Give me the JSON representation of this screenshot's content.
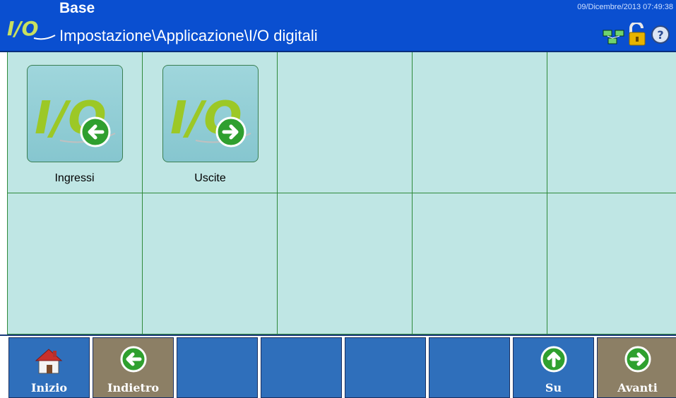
{
  "header": {
    "title": "Base",
    "path": "Impostazione\\Applicazione\\I/O digitali",
    "datetime": "09/Dicembre/2013 07:49:38",
    "logo_icon": "io-logo-icon",
    "status_icons": [
      "network-icon",
      "unlocked-padlock-icon",
      "help-icon"
    ]
  },
  "grid": {
    "items": [
      {
        "label": "Ingressi",
        "icon": "io-inputs-icon"
      },
      {
        "label": "Uscite",
        "icon": "io-outputs-icon"
      }
    ]
  },
  "toolbar": {
    "home_label": "Inizio",
    "back_label": "Indietro",
    "up_label": "Su",
    "next_label": "Avanti"
  },
  "colors": {
    "header": "#0a4fd0",
    "grid_background": "#bfe6e4",
    "grid_lines": "#2f8a3b",
    "button_blue": "#2f6fbb",
    "button_tan": "#8c7f65"
  }
}
